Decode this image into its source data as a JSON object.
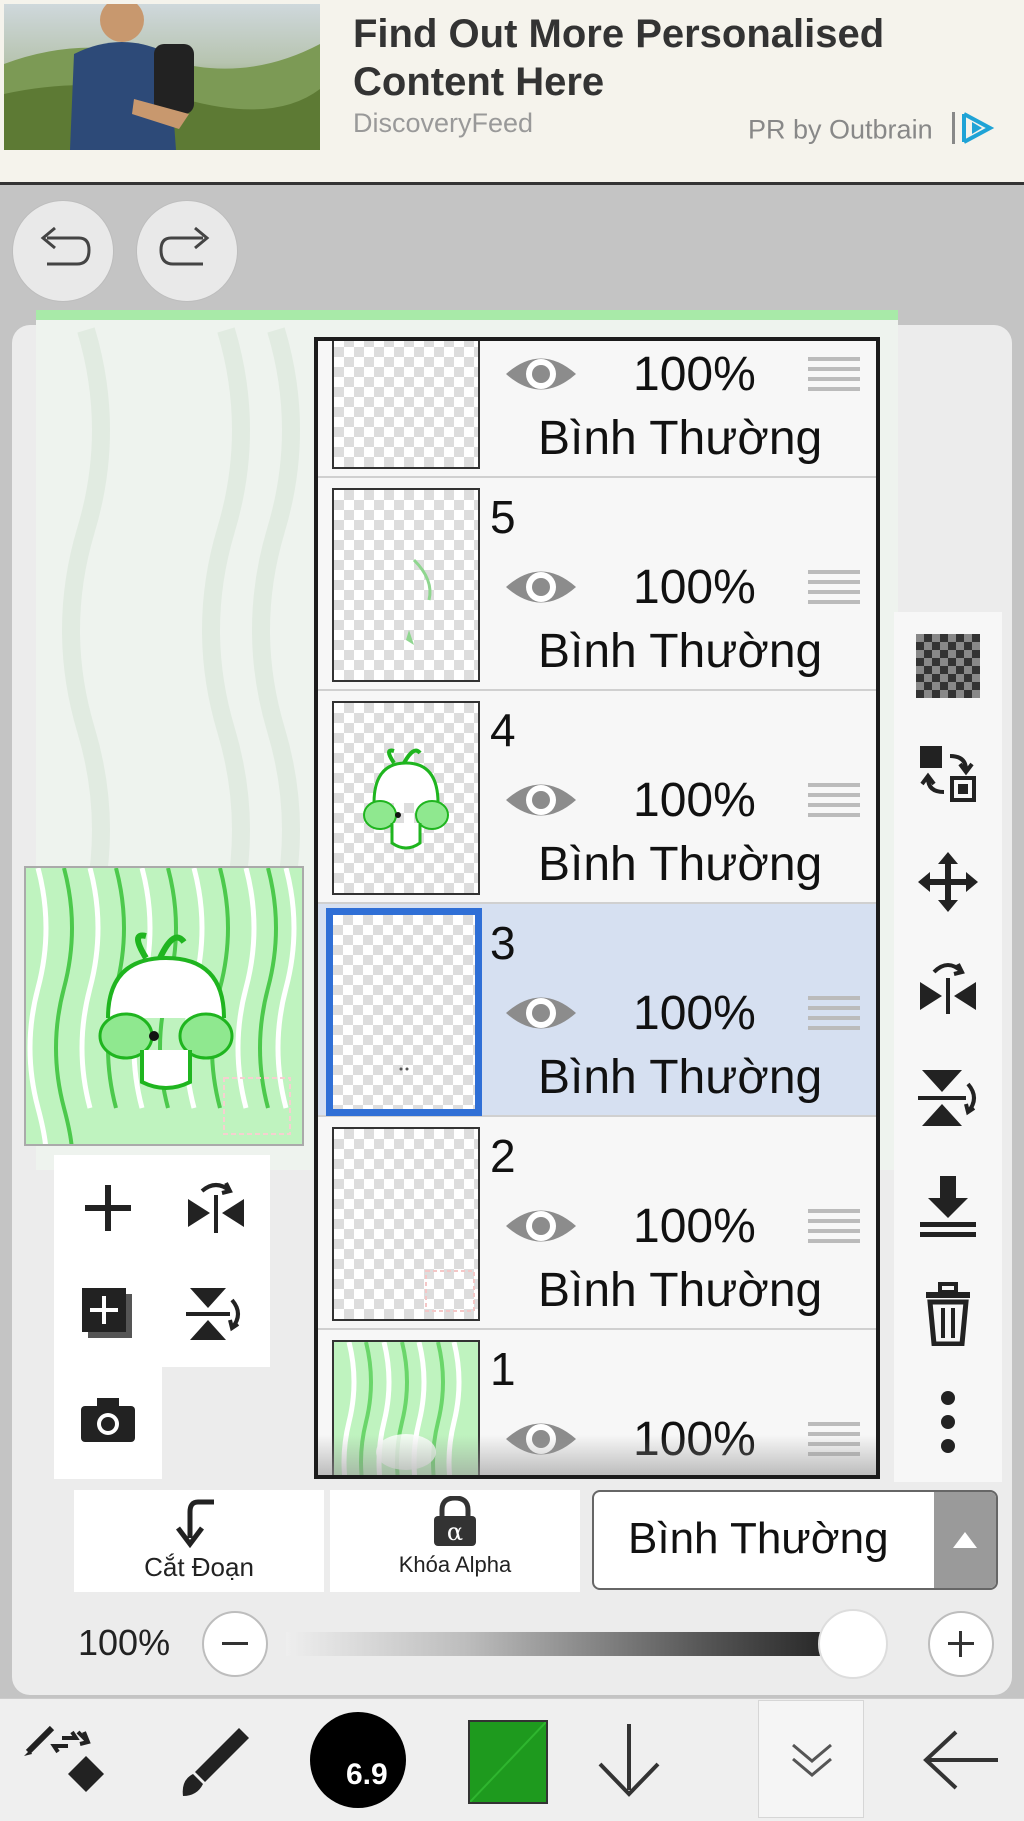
{
  "ad": {
    "title": "Find Out More Personalised Content Here",
    "source": "DiscoveryFeed",
    "sponsor": "PR by Outbrain"
  },
  "history": {
    "undo_icon": "undo-icon",
    "redo_icon": "redo-icon"
  },
  "layers": [
    {
      "number": "",
      "opacity": "100%",
      "mode": "Bình Thường",
      "selected": false
    },
    {
      "number": "5",
      "opacity": "100%",
      "mode": "Bình Thường",
      "selected": false
    },
    {
      "number": "4",
      "opacity": "100%",
      "mode": "Bình Thường",
      "selected": false
    },
    {
      "number": "3",
      "opacity": "100%",
      "mode": "Bình Thường",
      "selected": true
    },
    {
      "number": "2",
      "opacity": "100%",
      "mode": "Bình Thường",
      "selected": false
    },
    {
      "number": "1",
      "opacity": "100%",
      "mode": "",
      "selected": false
    }
  ],
  "right_tools": [
    "transparency-icon",
    "swap-layers-icon",
    "move-icon",
    "flip-horizontal-icon",
    "flip-vertical-icon",
    "merge-down-icon",
    "trash-icon",
    "more-vertical-icon"
  ],
  "left_tools": [
    "add-layer-icon",
    "flip-layer-icon",
    "add-copy-icon",
    "rotate-layer-icon",
    "camera-icon"
  ],
  "controls": {
    "clip_label": "Cắt Đoạn",
    "alpha_label": "Khóa Alpha",
    "blend_mode": "Bình Thường",
    "opacity_label": "100%",
    "opacity_value": 1.0
  },
  "bottom_bar": {
    "brush_size": "6.9",
    "color": "#1e9a1e"
  },
  "colors": {
    "accent": "#2f6fd6",
    "selected_row": "#d6e0f1",
    "drawing_green": "#1fb51f"
  }
}
